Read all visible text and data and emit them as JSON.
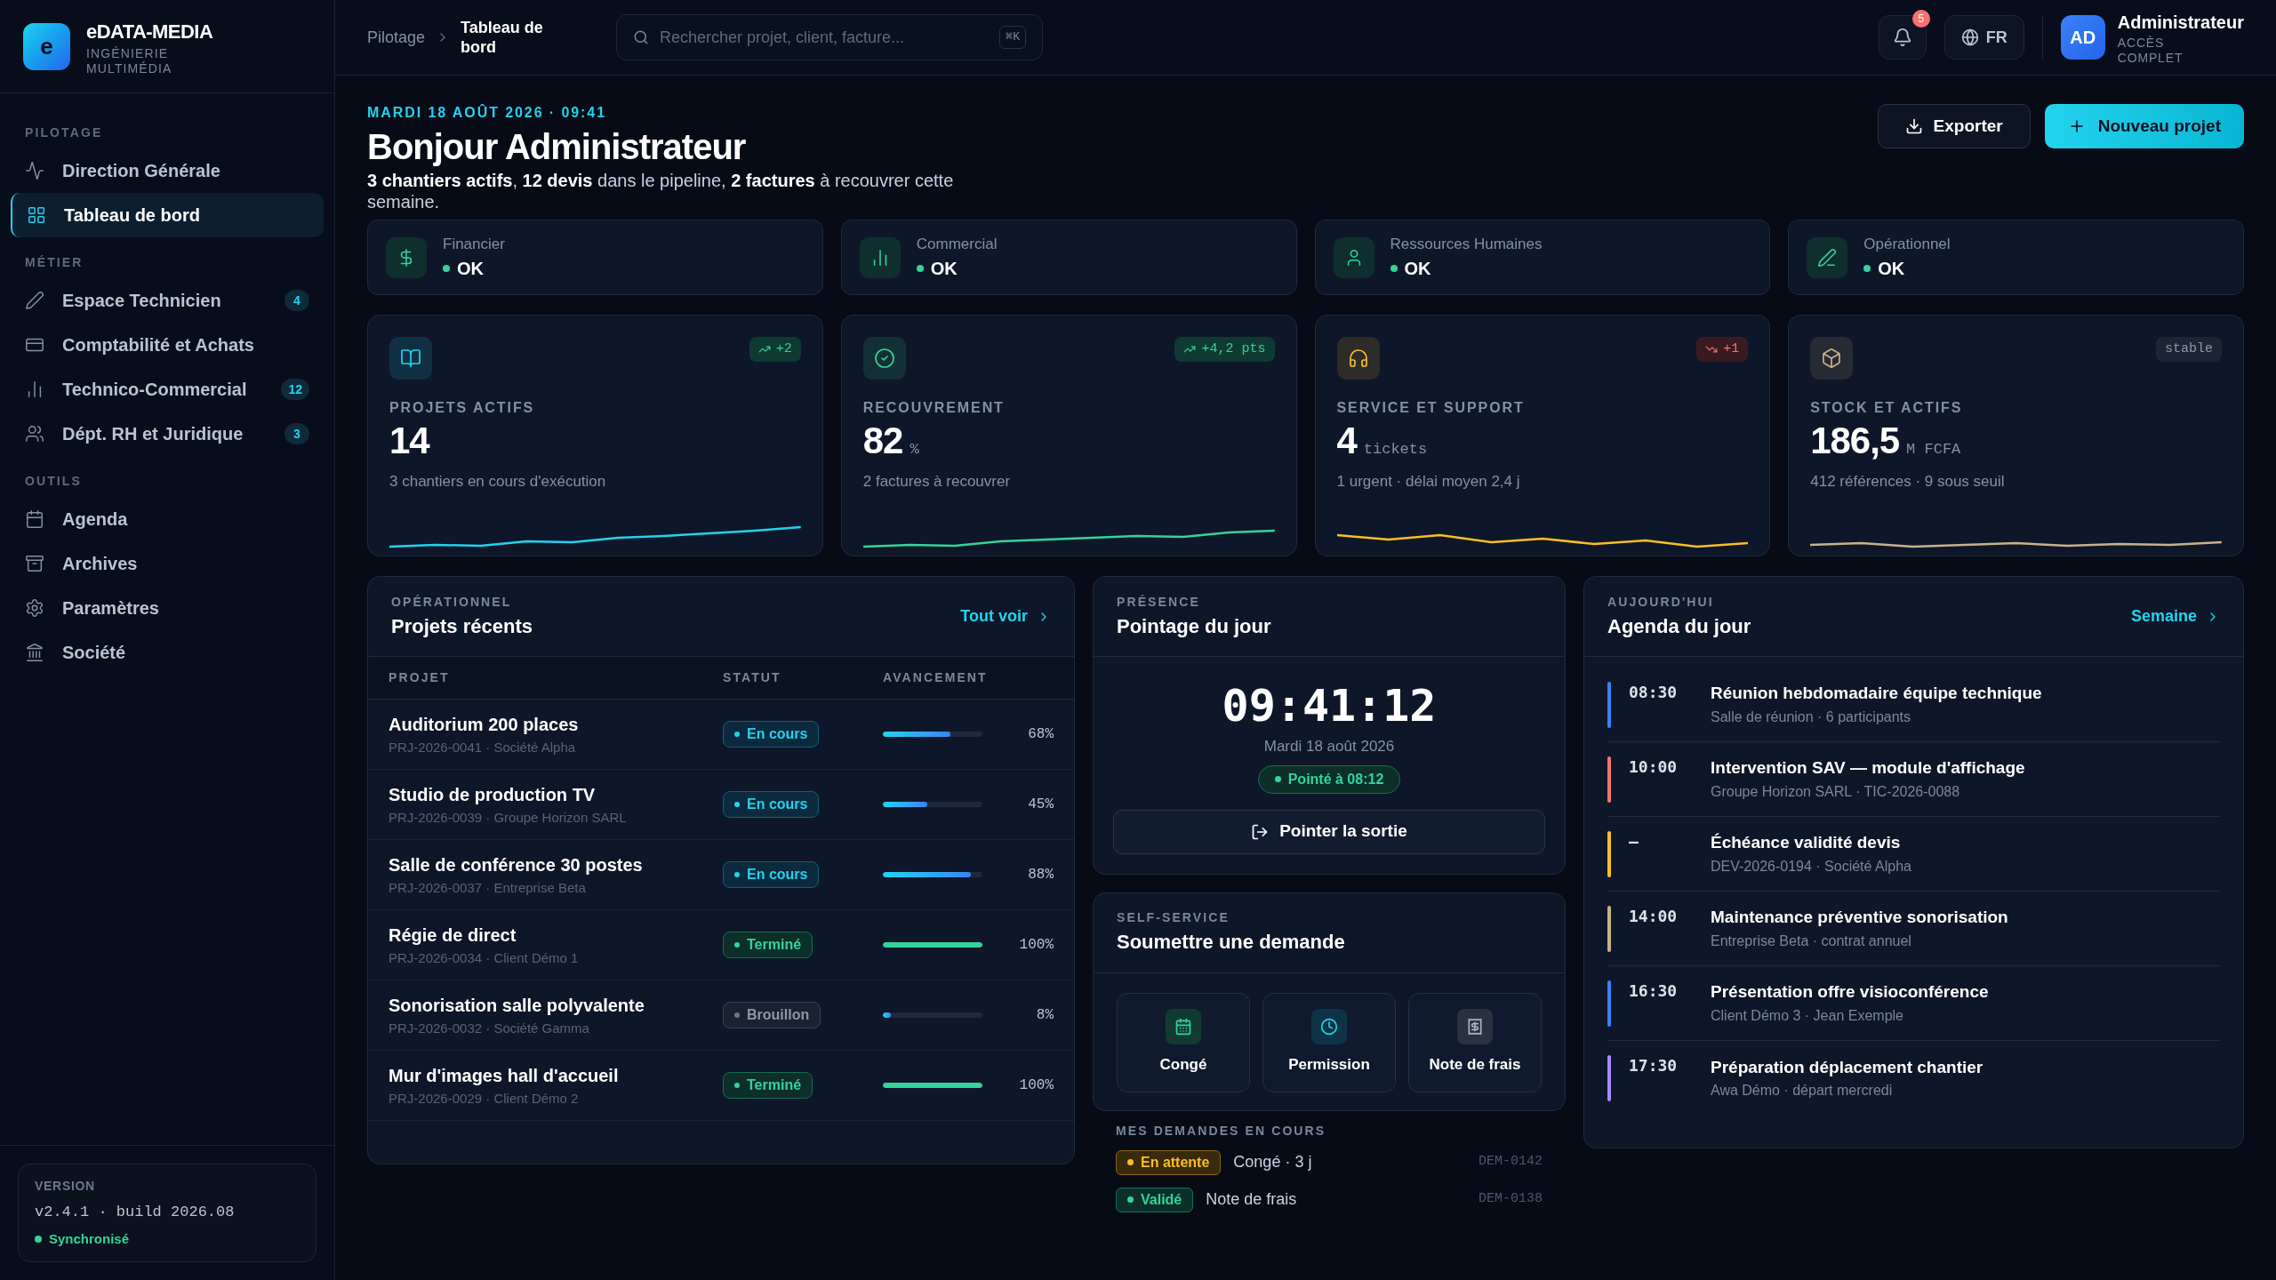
{
  "brand": {
    "logo_letter": "e",
    "name": "eDATA-MEDIA",
    "tagline": "INGÉNIERIE MULTIMÉDIA"
  },
  "sidebar": {
    "sections": [
      {
        "label": "PILOTAGE",
        "items": [
          {
            "label": "Direction Générale",
            "selected": false
          },
          {
            "label": "Tableau de bord",
            "selected": true
          }
        ]
      },
      {
        "label": "MÉTIER",
        "items": [
          {
            "label": "Espace Technicien",
            "selected": false,
            "badge": "4"
          },
          {
            "label": "Comptabilité et Achats",
            "selected": false
          },
          {
            "label": "Technico-Commercial",
            "selected": false,
            "badge": "12"
          },
          {
            "label": "Dépt. RH et Juridique",
            "selected": false,
            "badge": "3"
          }
        ]
      },
      {
        "label": "OUTILS",
        "items": [
          {
            "label": "Agenda",
            "selected": false
          },
          {
            "label": "Archives",
            "selected": false
          },
          {
            "label": "Paramètres",
            "selected": false
          },
          {
            "label": "Société",
            "selected": false
          }
        ]
      }
    ],
    "version": {
      "label": "VERSION",
      "value": "v2.4.1 · build 2026.08",
      "status": "Synchronisé"
    }
  },
  "header": {
    "breadcrumb": [
      "Pilotage",
      "Tableau de bord"
    ],
    "search": {
      "placeholder": "Rechercher projet, client, facture...",
      "shortcut": "⌘K"
    },
    "notifications": "5",
    "language": "FR",
    "user": {
      "initials": "AD",
      "name": "Administrateur",
      "role": "ACCÈS COMPLET"
    }
  },
  "greeting": {
    "date": "MARDI 18 AOÛT 2026 · 09:41",
    "title": "Bonjour Administrateur",
    "summary": "**3 chantiers actifs**, **12 devis** dans le pipeline, **2 factures** à recouvrer cette semaine.",
    "buttons": [
      "Exporter",
      "Nouveau projet"
    ]
  },
  "health": [
    {
      "label": "Financier",
      "value": "OK"
    },
    {
      "label": "Commercial",
      "value": "OK"
    },
    {
      "label": "Ressources Humaines",
      "value": "OK"
    },
    {
      "label": "Opérationnel",
      "value": "OK"
    }
  ],
  "kpis": [
    {
      "label": "PROJETS ACTIFS",
      "value": "14",
      "description": "3 chantiers en cours d'exécution",
      "color": "#22d3ee",
      "trend": {
        "kind": "up",
        "text": "+2"
      }
    },
    {
      "label": "RECOUVREMENT",
      "value": "82",
      "unit": "%",
      "description": "2 factures à recouvrer",
      "color": "#34d399",
      "trend": {
        "kind": "up",
        "text": "+4,2 pts"
      }
    },
    {
      "label": "SERVICE ET SUPPORT",
      "value": "4",
      "unit": "tickets",
      "description": "1 urgent · délai moyen 2,4 j",
      "color": "#fbbf24",
      "trend": {
        "kind": "down",
        "text": "+1"
      }
    },
    {
      "label": "STOCK ET ACTIFS",
      "value": "186,5",
      "unit": "M FCFA",
      "description": "412 références · 9 sous seuil",
      "color": "#c8b28a",
      "trend": {
        "kind": "flat",
        "text": "stable"
      }
    }
  ],
  "projects": {
    "eyebrow": "OPÉRATIONNEL",
    "title": "Projets récents",
    "link": "Tout voir",
    "columns": [
      "PROJET",
      "STATUT",
      "AVANCEMENT"
    ],
    "rows": [
      {
        "name": "Auditorium 200 places",
        "meta": "PRJ-2026-0041 · Société Alpha",
        "status": {
          "kind": "active",
          "label": "En cours"
        },
        "level": 0.68,
        "reading": "68%"
      },
      {
        "name": "Studio de production TV",
        "meta": "PRJ-2026-0039 · Groupe Horizon SARL",
        "status": {
          "kind": "active",
          "label": "En cours"
        },
        "level": 0.45,
        "reading": "45%"
      },
      {
        "name": "Salle de conférence 30 postes",
        "meta": "PRJ-2026-0037 · Entreprise Beta",
        "status": {
          "kind": "active",
          "label": "En cours"
        },
        "level": 0.88,
        "reading": "88%"
      },
      {
        "name": "Régie de direct",
        "meta": "PRJ-2026-0034 · Client Démo 1",
        "status": {
          "kind": "done",
          "label": "Terminé"
        },
        "level": 1,
        "reading": "100%"
      },
      {
        "name": "Sonorisation salle polyvalente",
        "meta": "PRJ-2026-0032 · Société Gamma",
        "status": {
          "kind": "draft",
          "label": "Brouillon"
        },
        "level": 0.08,
        "reading": "8%"
      },
      {
        "name": "Mur d'images hall d'accueil",
        "meta": "PRJ-2026-0029 · Client Démo 2",
        "status": {
          "kind": "done",
          "label": "Terminé"
        },
        "level": 1,
        "reading": "100%"
      }
    ]
  },
  "presence": {
    "eyebrow": "PRÉSENCE",
    "title": "Pointage du jour",
    "clock": "09:41:12",
    "date": "Mardi 18 août 2026",
    "badge": "Pointé à 08:12",
    "button": "Pointer la sortie"
  },
  "self_service": {
    "eyebrow": "SELF-SERVICE",
    "title": "Soumettre une demande",
    "options": [
      {
        "label": "Congé"
      },
      {
        "label": "Permission"
      },
      {
        "label": "Note de frais"
      }
    ],
    "requests": {
      "label": "MES DEMANDES EN COURS",
      "items": [
        {
          "kind": "pending",
          "badge": "En attente",
          "text": "Congé · 3 j",
          "ref": "DEM-0142"
        },
        {
          "kind": "approved",
          "badge": "Validé",
          "text": "Note de frais",
          "ref": "DEM-0138"
        }
      ]
    }
  },
  "agenda": {
    "eyebrow": "AUJOURD'HUI",
    "title": "Agenda du jour",
    "link": "Semaine",
    "events": [
      {
        "time": "08:30",
        "title": "Réunion hebdomadaire équipe technique",
        "meta": "Salle de réunion · 6 participants",
        "color": "#3b82f6"
      },
      {
        "time": "10:00",
        "title": "Intervention SAV — module d'affichage",
        "meta": "Groupe Horizon SARL · TIC-2026-0088",
        "color": "#f87171"
      },
      {
        "time": "–",
        "title": "Échéance validité devis",
        "meta": "DEV-2026-0194 · Société Alpha",
        "color": "#fbbf24"
      },
      {
        "time": "14:00",
        "title": "Maintenance préventive sonorisation",
        "meta": "Entreprise Beta · contrat annuel",
        "color": "#c8b28a"
      },
      {
        "time": "16:30",
        "title": "Présentation offre visioconférence",
        "meta": "Client Démo 3 · Jean Exemple",
        "color": "#3b82f6"
      },
      {
        "time": "17:30",
        "title": "Préparation déplacement chantier",
        "meta": "Awa Démo · départ mercredi",
        "color": "#a78bfa"
      }
    ]
  }
}
